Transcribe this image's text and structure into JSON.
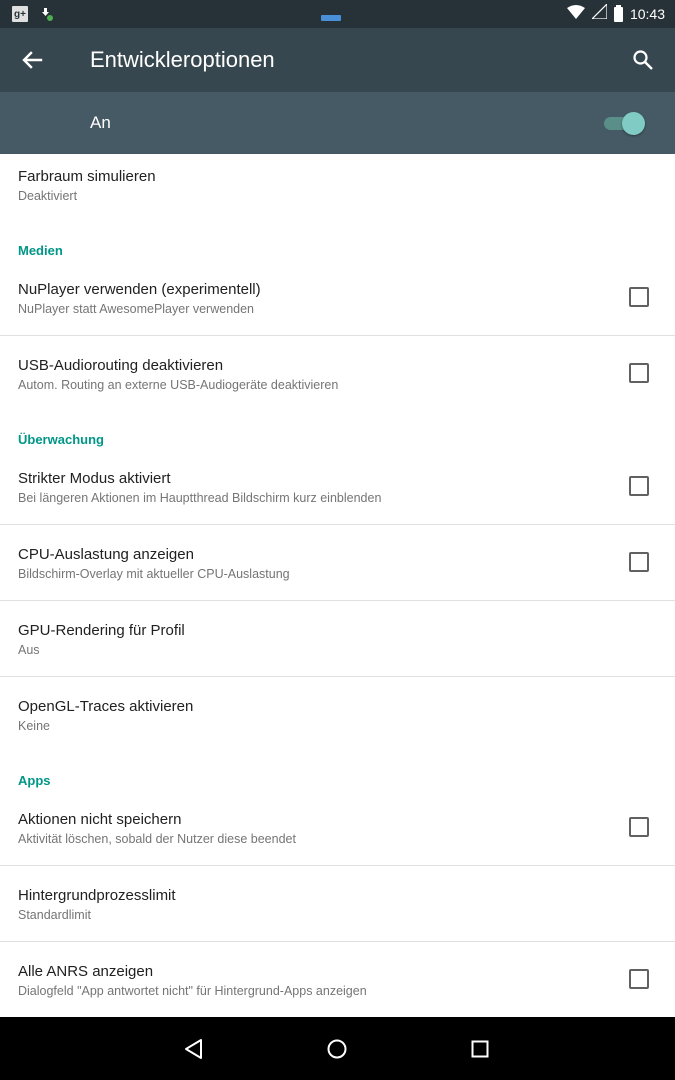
{
  "status_bar": {
    "time": "10:43",
    "left_icons": [
      "google-plus-icon",
      "download-icon"
    ],
    "right_icons": [
      "wifi-icon",
      "signal-icon",
      "battery-icon"
    ],
    "gplus_text": "g+"
  },
  "toolbar": {
    "title": "Entwickleroptionen",
    "back_icon": "arrow-back-icon",
    "search_icon": "search-icon"
  },
  "master_switch": {
    "label": "An",
    "on": true
  },
  "colors": {
    "toolbar": "#37474f",
    "switch_bar": "#455a64",
    "accent": "#009688",
    "status_bar": "#263238"
  },
  "list": {
    "farbraum": {
      "title": "Farbraum simulieren",
      "subtitle": "Deaktiviert"
    },
    "section_medien": "Medien",
    "nuplayer": {
      "title": "NuPlayer verwenden (experimentell)",
      "subtitle": "NuPlayer statt AwesomePlayer verwenden",
      "checked": false
    },
    "usb_audio": {
      "title": "USB-Audiorouting deaktivieren",
      "subtitle": "Autom. Routing an externe USB-Audiogeräte deaktivieren",
      "checked": false
    },
    "section_ueberwachung": "Überwachung",
    "strict_mode": {
      "title": "Strikter Modus aktiviert",
      "subtitle": "Bei längeren Aktionen im Hauptthread Bildschirm kurz einblenden",
      "checked": false
    },
    "cpu_usage": {
      "title": "CPU-Auslastung anzeigen",
      "subtitle": "Bildschirm-Overlay mit aktueller CPU-Auslastung",
      "checked": false
    },
    "gpu_rendering": {
      "title": "GPU-Rendering für Profil",
      "subtitle": "Aus"
    },
    "opengl_traces": {
      "title": "OpenGL-Traces aktivieren",
      "subtitle": "Keine"
    },
    "section_apps": "Apps",
    "dont_keep": {
      "title": "Aktionen nicht speichern",
      "subtitle": "Aktivität löschen, sobald der Nutzer diese beendet",
      "checked": false
    },
    "bg_limit": {
      "title": "Hintergrundprozesslimit",
      "subtitle": "Standardlimit"
    },
    "anrs": {
      "title": "Alle ANRS anzeigen",
      "subtitle": "Dialogfeld \"App antwortet nicht\" für Hintergrund-Apps anzeigen",
      "checked": false
    }
  },
  "nav_bar": {
    "back": "nav-back-icon",
    "home": "nav-home-icon",
    "recents": "nav-recents-icon"
  }
}
